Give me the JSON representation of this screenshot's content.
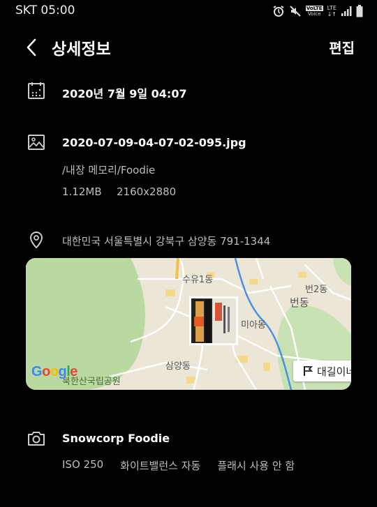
{
  "status_bar": {
    "carrier_time": "SKT 05:00",
    "icons": [
      "alarm-icon",
      "mute-icon",
      "volte-icon",
      "lte-icon",
      "signal-icon",
      "battery-icon"
    ],
    "volte_top": "VoLTE",
    "volte_bottom": "Voice",
    "lte": "LTE"
  },
  "header": {
    "title": "상세정보",
    "edit_label": "편집"
  },
  "date": {
    "value": "2020년 7월 9일 04:07"
  },
  "file": {
    "name": "2020-07-09-04-07-02-095.jpg",
    "path": "/내장 메모리/Foodie",
    "size": "1.12MB",
    "resolution": "2160x2880"
  },
  "location": {
    "address": "대한민국 서울특별시 강북구 삼양동 791-1344"
  },
  "map": {
    "labels": {
      "suyu": "수유1동",
      "beon2": "번2동",
      "beondong": "번동",
      "mia": "미아동",
      "samyang": "삼양동",
      "park": "북한산국립공원"
    },
    "logo": {
      "g1": "G",
      "o1": "o",
      "o2": "o",
      "g2": "g",
      "l": "l",
      "e": "e"
    },
    "directions_label": "대길이네"
  },
  "camera": {
    "model": "Snowcorp Foodie",
    "iso": "ISO 250",
    "white_balance": "화이트밸런스 자동",
    "flash": "플래시 사용 안 함"
  },
  "colors": {
    "background": "#000000",
    "text": "#ffffff",
    "subtext": "#bdbdbd",
    "map_bg": "#ece6d6",
    "park_green": "#b9d9a0",
    "river_blue": "#4a90e2"
  }
}
